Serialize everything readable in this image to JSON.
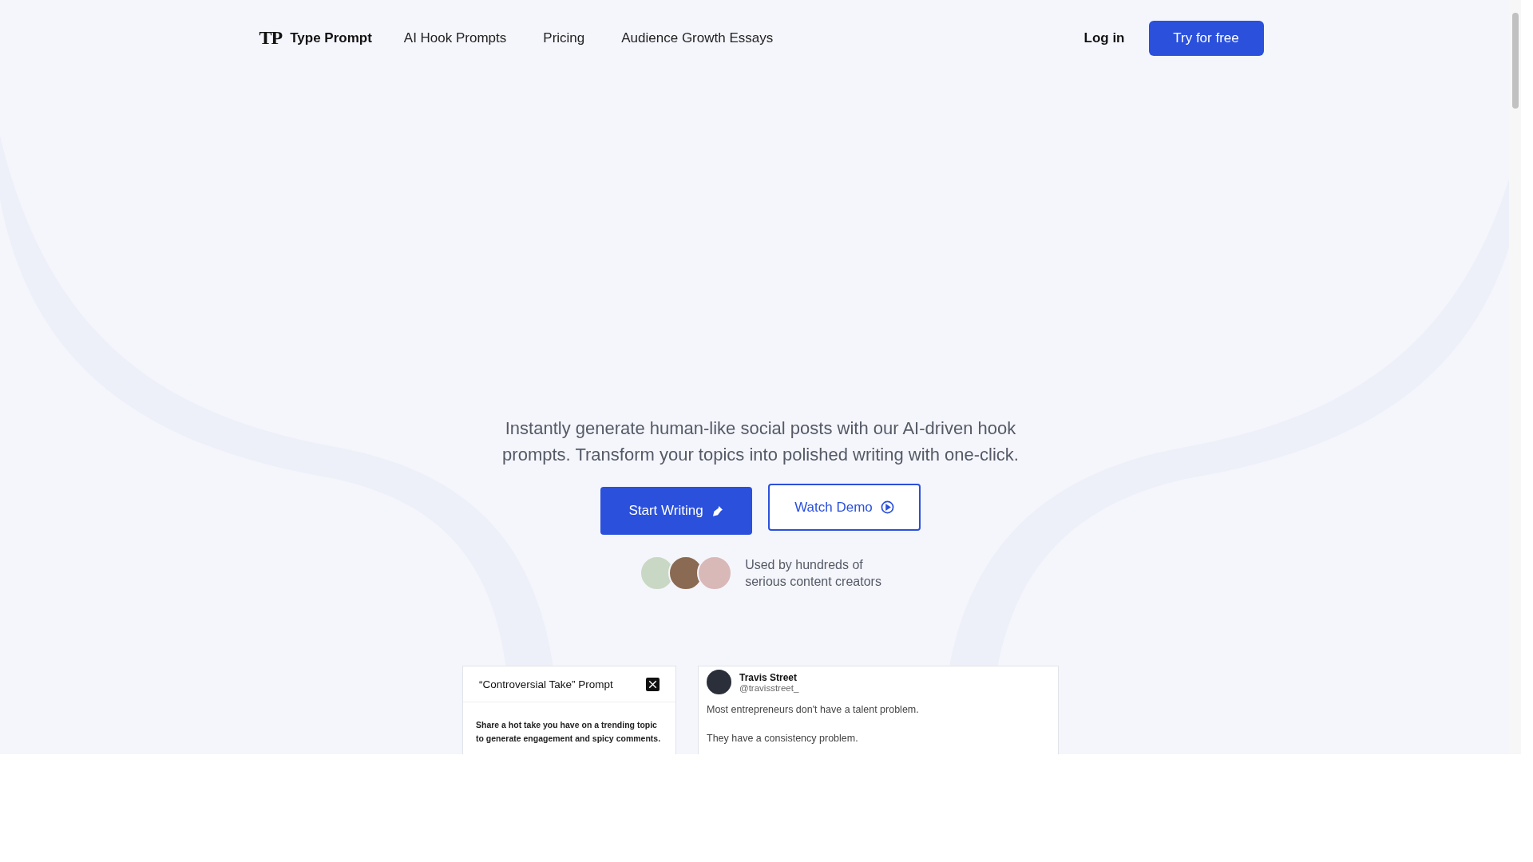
{
  "header": {
    "logo": {
      "mark": "TP",
      "name": "Type Prompt"
    },
    "nav": [
      {
        "label": "AI Hook Prompts"
      },
      {
        "label": "Pricing"
      },
      {
        "label": "Audience Growth Essays"
      }
    ],
    "login": "Log in",
    "cta": "Try for free"
  },
  "hero": {
    "description": "Instantly generate human-like social posts with our AI-driven hook prompts. Transform your topics into polished writing with one-click.",
    "primary_button": "Start Writing",
    "secondary_button": "Watch Demo",
    "social_proof": [
      "Used by hundreds of",
      "serious content creators"
    ]
  },
  "preview": {
    "prompt_card": {
      "title": "“Controversial Take” Prompt",
      "description": "Share a hot take you have on a trending topic to generate engagement and spicy comments."
    },
    "post": {
      "author": "Travis Street",
      "handle": "@travisstreet_",
      "lines": [
        "Most entrepreneurs don't have a talent problem.",
        "They have a consistency problem."
      ]
    }
  }
}
